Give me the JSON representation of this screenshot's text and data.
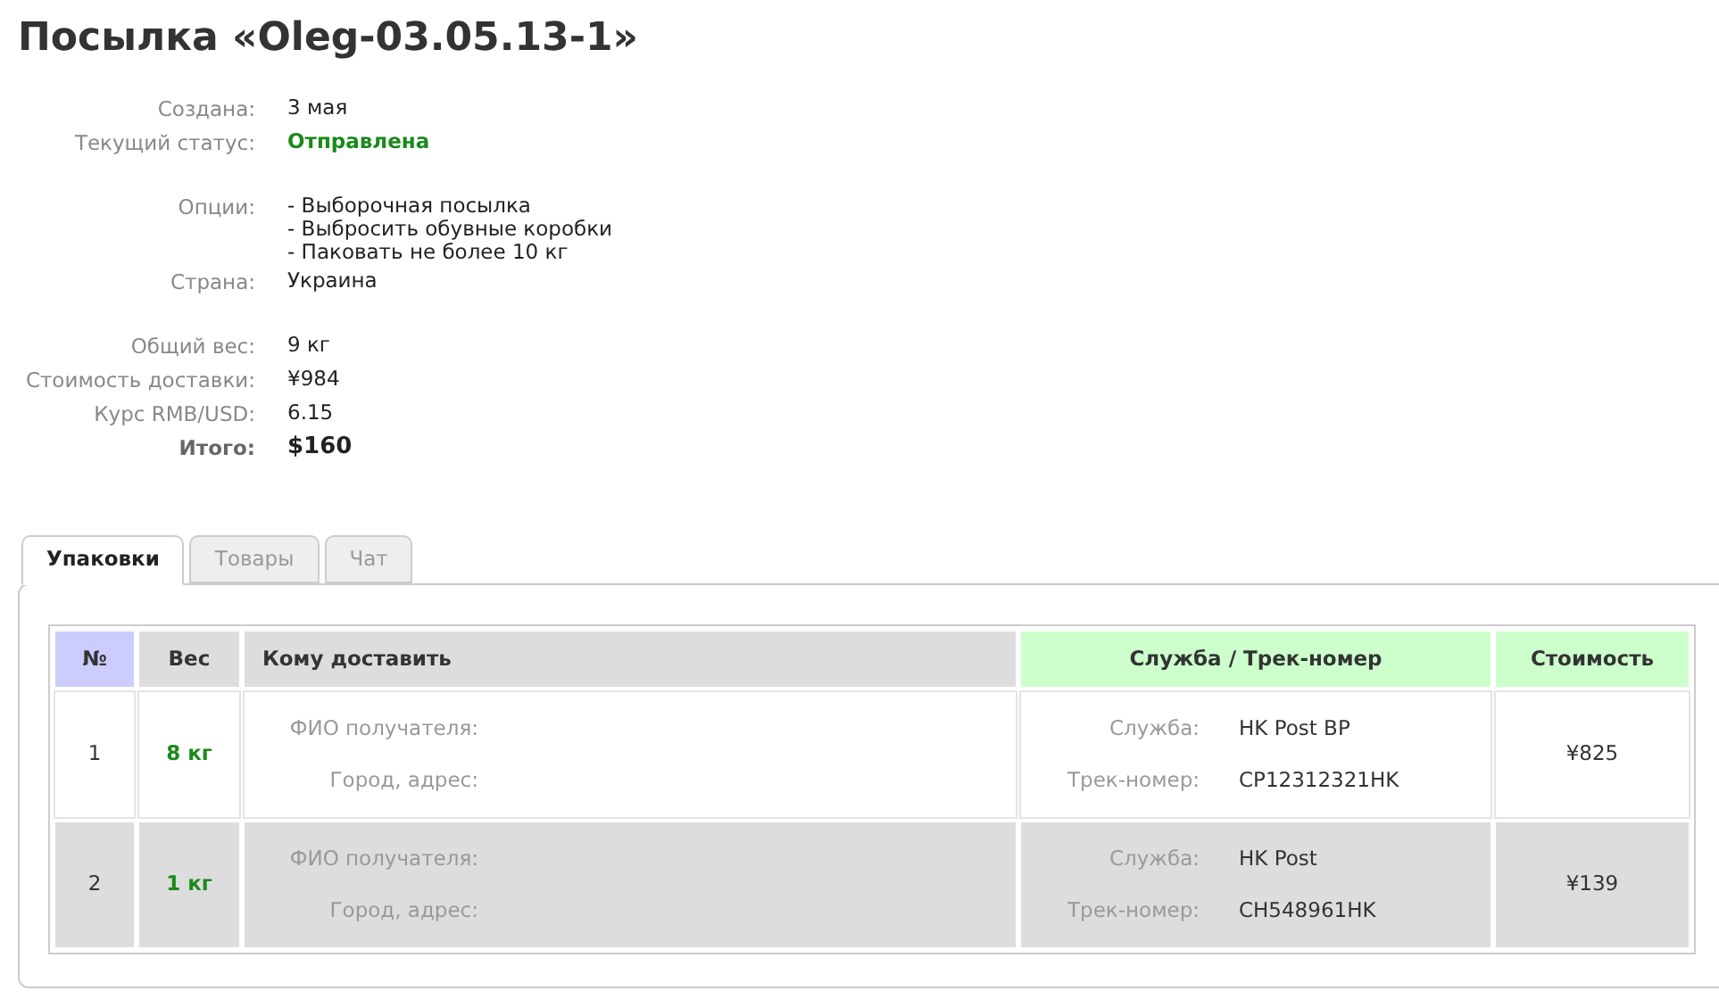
{
  "title": "Посылка «Oleg-03.05.13-1»",
  "info_groups": [
    [
      {
        "label": "Создана:",
        "kind": "plain",
        "value": [
          "3 мая"
        ]
      },
      {
        "label": "Текущий статус:",
        "kind": "status",
        "value": [
          "Отправлена"
        ]
      }
    ],
    [
      {
        "label": "Опции:",
        "kind": "plain",
        "value": [
          "- Выборочная посылка",
          "- Выбросить обувные коробки",
          "- Паковать не более 10 кг"
        ]
      },
      {
        "label": "Страна:",
        "kind": "plain",
        "value": [
          "Украина"
        ]
      }
    ],
    [
      {
        "label": "Общий вес:",
        "kind": "plain",
        "value": [
          "9 кг"
        ]
      },
      {
        "label": "Стоимость доставки:",
        "kind": "plain",
        "value": [
          "¥984"
        ]
      },
      {
        "label": "Курс RMB/USD:",
        "kind": "plain",
        "value": [
          "6.15"
        ]
      },
      {
        "label": "Итого:",
        "kind": "total",
        "value": [
          "$160"
        ]
      }
    ]
  ],
  "tabs": [
    {
      "label": "Упаковки",
      "selected": true
    },
    {
      "label": "Товары",
      "selected": false
    },
    {
      "label": "Чат",
      "selected": false
    }
  ],
  "table": {
    "columns": [
      {
        "label": "№",
        "color": "#ccccff"
      },
      {
        "label": "Вес",
        "color": "#dddddd"
      },
      {
        "label": "Кому доставить",
        "color": "#dddddd"
      },
      {
        "label": "Служба / Трек-номер",
        "color": "#ccffcc"
      },
      {
        "label": "Стоимость",
        "color": "#ccffcc"
      }
    ],
    "rows": [
      {
        "number": "1",
        "weight": "8 кг",
        "recipient_labels": [
          "ФИО получателя:",
          "Город, адрес:"
        ],
        "service_labels": [
          "Служба:",
          "Трек-номер:"
        ],
        "service": "HK Post BP",
        "track": "CP12312321HK",
        "cost": "¥825",
        "shaded": false
      },
      {
        "number": "2",
        "weight": "1 кг",
        "recipient_labels": [
          "ФИО получателя:",
          "Город, адрес:"
        ],
        "service_labels": [
          "Служба:",
          "Трек-номер:"
        ],
        "service": "HK Post",
        "track": "CH548961HK",
        "cost": "¥139",
        "shaded": true
      }
    ]
  }
}
